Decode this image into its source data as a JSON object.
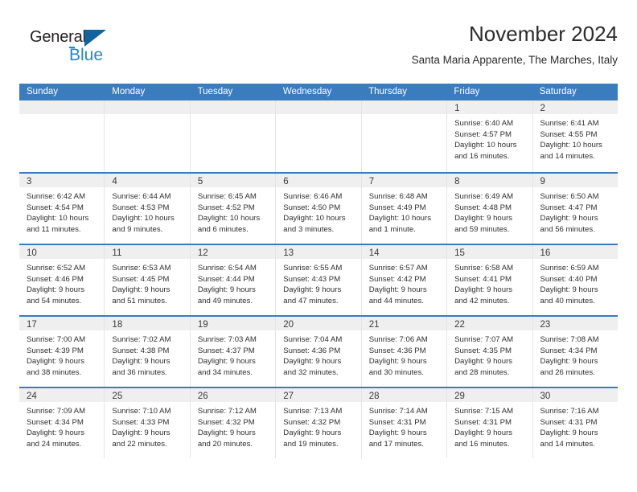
{
  "brand": {
    "name_part1": "General",
    "name_part2": "Blue",
    "triangle_color": "#1263a0",
    "blue_color": "#2787c8"
  },
  "header": {
    "month_title": "November 2024",
    "location": "Santa Maria Apparente, The Marches, Italy"
  },
  "theme": {
    "header_blue": "#3a7cbe",
    "band_gray": "#efefef",
    "text": "#2f2f2f"
  },
  "calendar": {
    "weekdays": [
      "Sunday",
      "Monday",
      "Tuesday",
      "Wednesday",
      "Thursday",
      "Friday",
      "Saturday"
    ],
    "weeks": [
      [
        {
          "day": "",
          "empty": true
        },
        {
          "day": "",
          "empty": true
        },
        {
          "day": "",
          "empty": true
        },
        {
          "day": "",
          "empty": true
        },
        {
          "day": "",
          "empty": true
        },
        {
          "day": "1",
          "sunrise": "Sunrise: 6:40 AM",
          "sunset": "Sunset: 4:57 PM",
          "daylight": "Daylight: 10 hours and 16 minutes."
        },
        {
          "day": "2",
          "sunrise": "Sunrise: 6:41 AM",
          "sunset": "Sunset: 4:55 PM",
          "daylight": "Daylight: 10 hours and 14 minutes."
        }
      ],
      [
        {
          "day": "3",
          "sunrise": "Sunrise: 6:42 AM",
          "sunset": "Sunset: 4:54 PM",
          "daylight": "Daylight: 10 hours and 11 minutes."
        },
        {
          "day": "4",
          "sunrise": "Sunrise: 6:44 AM",
          "sunset": "Sunset: 4:53 PM",
          "daylight": "Daylight: 10 hours and 9 minutes."
        },
        {
          "day": "5",
          "sunrise": "Sunrise: 6:45 AM",
          "sunset": "Sunset: 4:52 PM",
          "daylight": "Daylight: 10 hours and 6 minutes."
        },
        {
          "day": "6",
          "sunrise": "Sunrise: 6:46 AM",
          "sunset": "Sunset: 4:50 PM",
          "daylight": "Daylight: 10 hours and 3 minutes."
        },
        {
          "day": "7",
          "sunrise": "Sunrise: 6:48 AM",
          "sunset": "Sunset: 4:49 PM",
          "daylight": "Daylight: 10 hours and 1 minute."
        },
        {
          "day": "8",
          "sunrise": "Sunrise: 6:49 AM",
          "sunset": "Sunset: 4:48 PM",
          "daylight": "Daylight: 9 hours and 59 minutes."
        },
        {
          "day": "9",
          "sunrise": "Sunrise: 6:50 AM",
          "sunset": "Sunset: 4:47 PM",
          "daylight": "Daylight: 9 hours and 56 minutes."
        }
      ],
      [
        {
          "day": "10",
          "sunrise": "Sunrise: 6:52 AM",
          "sunset": "Sunset: 4:46 PM",
          "daylight": "Daylight: 9 hours and 54 minutes."
        },
        {
          "day": "11",
          "sunrise": "Sunrise: 6:53 AM",
          "sunset": "Sunset: 4:45 PM",
          "daylight": "Daylight: 9 hours and 51 minutes."
        },
        {
          "day": "12",
          "sunrise": "Sunrise: 6:54 AM",
          "sunset": "Sunset: 4:44 PM",
          "daylight": "Daylight: 9 hours and 49 minutes."
        },
        {
          "day": "13",
          "sunrise": "Sunrise: 6:55 AM",
          "sunset": "Sunset: 4:43 PM",
          "daylight": "Daylight: 9 hours and 47 minutes."
        },
        {
          "day": "14",
          "sunrise": "Sunrise: 6:57 AM",
          "sunset": "Sunset: 4:42 PM",
          "daylight": "Daylight: 9 hours and 44 minutes."
        },
        {
          "day": "15",
          "sunrise": "Sunrise: 6:58 AM",
          "sunset": "Sunset: 4:41 PM",
          "daylight": "Daylight: 9 hours and 42 minutes."
        },
        {
          "day": "16",
          "sunrise": "Sunrise: 6:59 AM",
          "sunset": "Sunset: 4:40 PM",
          "daylight": "Daylight: 9 hours and 40 minutes."
        }
      ],
      [
        {
          "day": "17",
          "sunrise": "Sunrise: 7:00 AM",
          "sunset": "Sunset: 4:39 PM",
          "daylight": "Daylight: 9 hours and 38 minutes."
        },
        {
          "day": "18",
          "sunrise": "Sunrise: 7:02 AM",
          "sunset": "Sunset: 4:38 PM",
          "daylight": "Daylight: 9 hours and 36 minutes."
        },
        {
          "day": "19",
          "sunrise": "Sunrise: 7:03 AM",
          "sunset": "Sunset: 4:37 PM",
          "daylight": "Daylight: 9 hours and 34 minutes."
        },
        {
          "day": "20",
          "sunrise": "Sunrise: 7:04 AM",
          "sunset": "Sunset: 4:36 PM",
          "daylight": "Daylight: 9 hours and 32 minutes."
        },
        {
          "day": "21",
          "sunrise": "Sunrise: 7:06 AM",
          "sunset": "Sunset: 4:36 PM",
          "daylight": "Daylight: 9 hours and 30 minutes."
        },
        {
          "day": "22",
          "sunrise": "Sunrise: 7:07 AM",
          "sunset": "Sunset: 4:35 PM",
          "daylight": "Daylight: 9 hours and 28 minutes."
        },
        {
          "day": "23",
          "sunrise": "Sunrise: 7:08 AM",
          "sunset": "Sunset: 4:34 PM",
          "daylight": "Daylight: 9 hours and 26 minutes."
        }
      ],
      [
        {
          "day": "24",
          "sunrise": "Sunrise: 7:09 AM",
          "sunset": "Sunset: 4:34 PM",
          "daylight": "Daylight: 9 hours and 24 minutes."
        },
        {
          "day": "25",
          "sunrise": "Sunrise: 7:10 AM",
          "sunset": "Sunset: 4:33 PM",
          "daylight": "Daylight: 9 hours and 22 minutes."
        },
        {
          "day": "26",
          "sunrise": "Sunrise: 7:12 AM",
          "sunset": "Sunset: 4:32 PM",
          "daylight": "Daylight: 9 hours and 20 minutes."
        },
        {
          "day": "27",
          "sunrise": "Sunrise: 7:13 AM",
          "sunset": "Sunset: 4:32 PM",
          "daylight": "Daylight: 9 hours and 19 minutes."
        },
        {
          "day": "28",
          "sunrise": "Sunrise: 7:14 AM",
          "sunset": "Sunset: 4:31 PM",
          "daylight": "Daylight: 9 hours and 17 minutes."
        },
        {
          "day": "29",
          "sunrise": "Sunrise: 7:15 AM",
          "sunset": "Sunset: 4:31 PM",
          "daylight": "Daylight: 9 hours and 16 minutes."
        },
        {
          "day": "30",
          "sunrise": "Sunrise: 7:16 AM",
          "sunset": "Sunset: 4:31 PM",
          "daylight": "Daylight: 9 hours and 14 minutes."
        }
      ]
    ]
  }
}
